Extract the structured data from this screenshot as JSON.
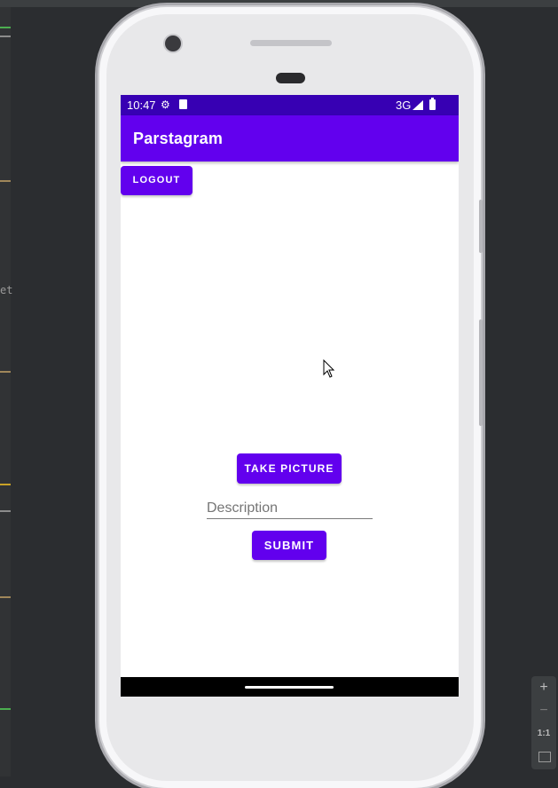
{
  "ide": {
    "side_text": "et"
  },
  "status_bar": {
    "time": "10:47",
    "network": "3G"
  },
  "app_bar": {
    "title": "Parstagram"
  },
  "buttons": {
    "logout": "LOGOUT",
    "take_picture": "TAKE PICTURE",
    "submit": "SUBMIT"
  },
  "description_field": {
    "placeholder": "Description",
    "value": ""
  },
  "zoom_controls": {
    "zoom_in": "+",
    "zoom_out": "−",
    "actual_size": "1:1"
  }
}
